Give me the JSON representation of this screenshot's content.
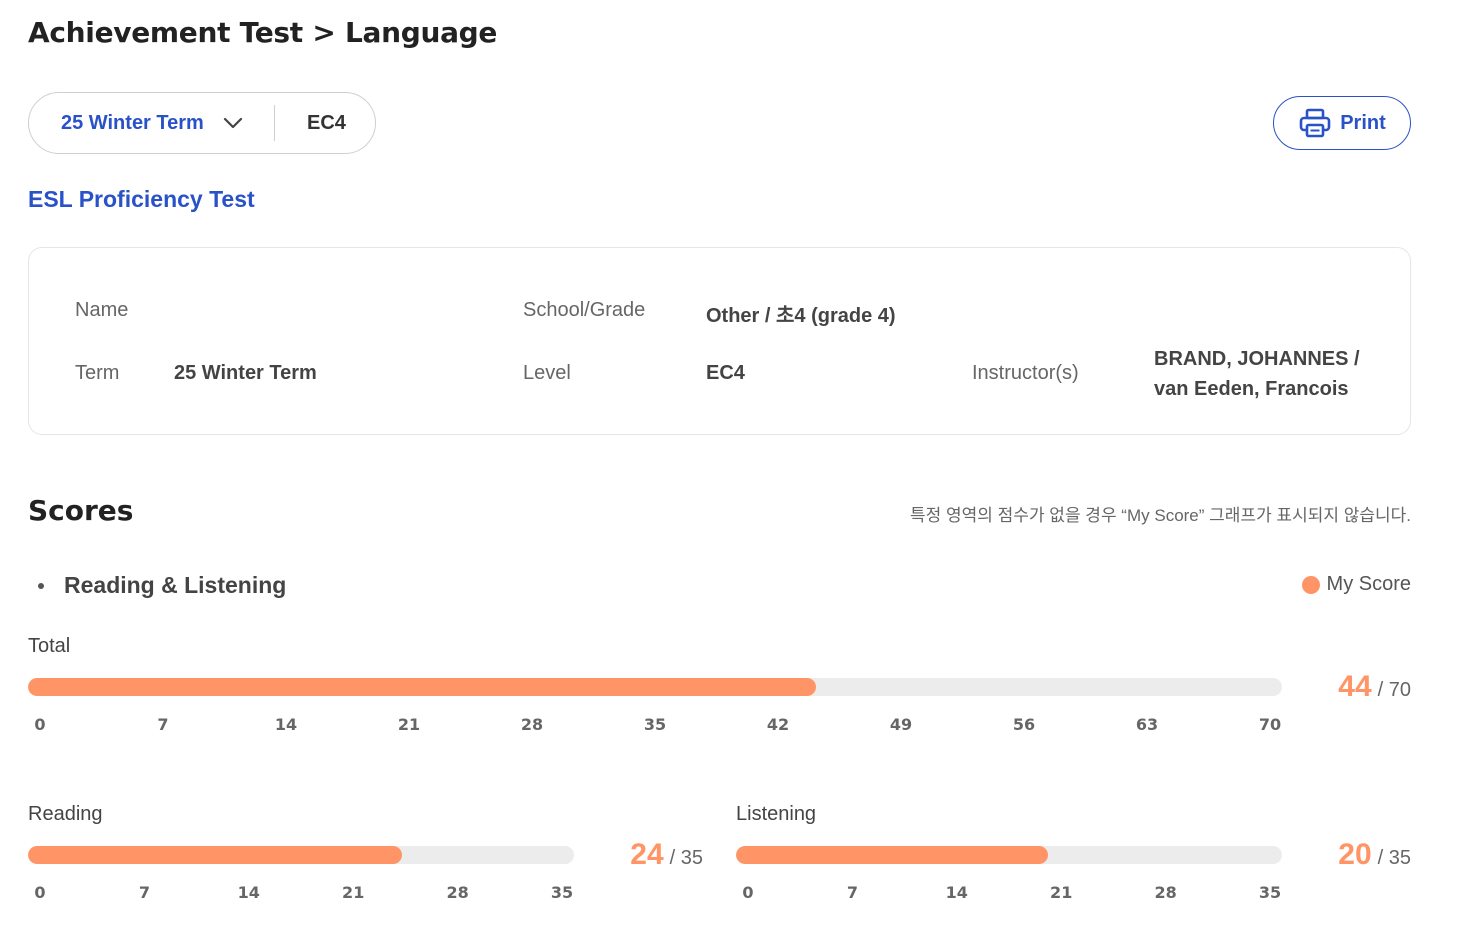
{
  "page": {
    "title": "Achievement Test > Language"
  },
  "filter": {
    "term": "25 Winter Term",
    "level": "EC4"
  },
  "toolbar": {
    "print_label": "Print"
  },
  "test": {
    "name": "ESL Proficiency Test"
  },
  "info": {
    "name_label": "Name",
    "name_value": "",
    "school_label": "School/Grade",
    "school_value": "Other / 초4 (grade 4)",
    "term_label": "Term",
    "term_value": "25 Winter Term",
    "level_label": "Level",
    "level_value": "EC4",
    "instructor_label": "Instructor(s)",
    "instructor_line1": "BRAND, JOHANNES /",
    "instructor_line2": "van Eeden, Francois"
  },
  "scores": {
    "title": "Scores",
    "note": "특정 영역의 점수가 없을 경우 “My Score” 그래프가 표시되지 않습니다.",
    "section_title": "Reading & Listening",
    "legend_label": "My Score",
    "legend_color": "#ff9566"
  },
  "chart_data": [
    {
      "type": "bar",
      "label": "Total",
      "value": 44,
      "max": 70,
      "score_display": "44",
      "max_display": "/ 70",
      "ticks": [
        "0",
        "7",
        "14",
        "21",
        "28",
        "35",
        "42",
        "49",
        "56",
        "63",
        "70"
      ]
    },
    {
      "type": "bar",
      "label": "Reading",
      "value": 24,
      "max": 35,
      "score_display": "24",
      "max_display": "/ 35",
      "ticks": [
        "0",
        "7",
        "14",
        "21",
        "28",
        "35"
      ]
    },
    {
      "type": "bar",
      "label": "Listening",
      "value": 20,
      "max": 35,
      "score_display": "20",
      "max_display": "/ 35",
      "ticks": [
        "0",
        "7",
        "14",
        "21",
        "28",
        "35"
      ]
    }
  ]
}
